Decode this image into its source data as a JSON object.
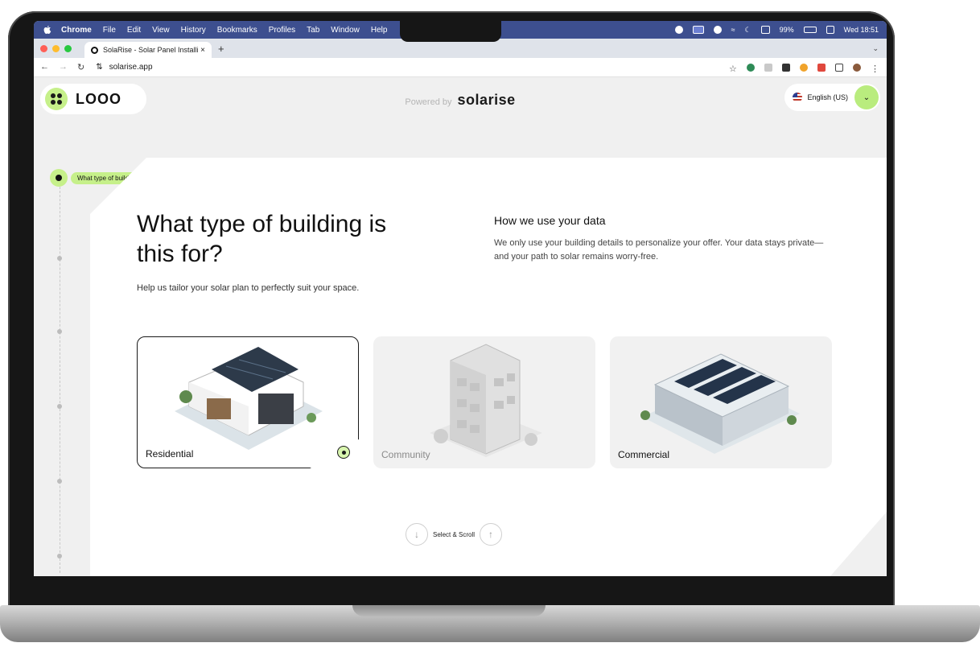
{
  "menubar": {
    "items": [
      "Chrome",
      "File",
      "Edit",
      "View",
      "History",
      "Bookmarks",
      "Profiles",
      "Tab",
      "Window",
      "Help"
    ],
    "battery": "99%",
    "clock": "Wed 18:51"
  },
  "browser": {
    "tab_title": "SolaRise - Solar Panel Installi",
    "url": "solarise.app"
  },
  "header": {
    "logo_text": "LOOO",
    "powered_prefix": "Powered by",
    "powered_brand": "solarise",
    "language": "English (US)"
  },
  "steps": {
    "current_label": "What type of building is this for?"
  },
  "main": {
    "heading": "What type of building is this for?",
    "subtext": "Help us tailor your solar plan to perfectly suit your space.",
    "info_title": "How we use your data",
    "info_body": "We only use your building details to personalize your offer. Your data stays private—and your path to solar remains worry-free.",
    "options": [
      {
        "label": "Residential",
        "selected": true
      },
      {
        "label": "Community",
        "selected": false
      },
      {
        "label": "Commercial",
        "selected": false
      }
    ],
    "scroll_hint": "Select & Scroll"
  },
  "colors": {
    "accent_green": "#c6f08a",
    "menubar": "#3d4f8f"
  }
}
